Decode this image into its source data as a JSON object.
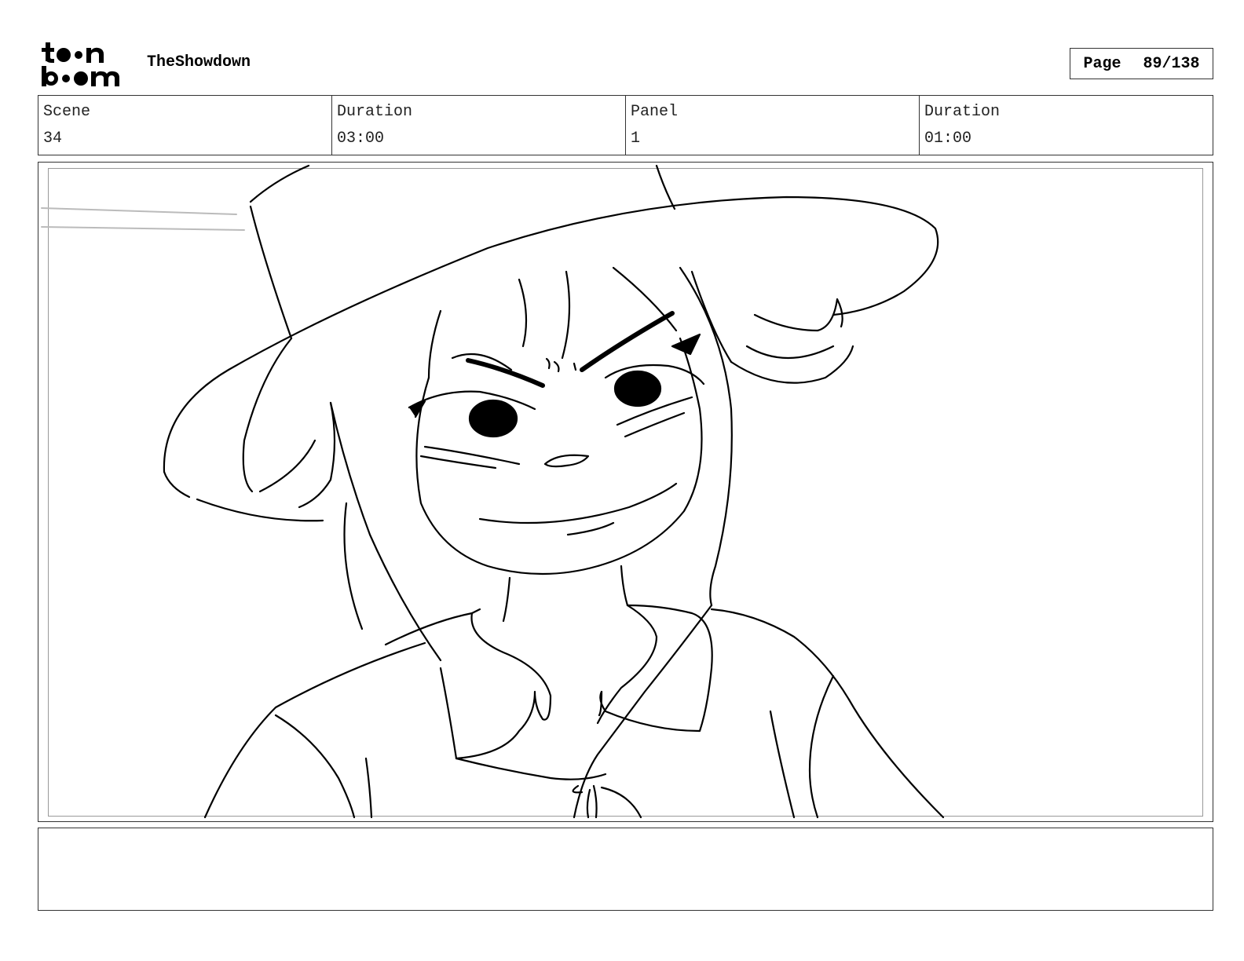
{
  "header": {
    "logo_text": "toonboom",
    "project_title": "TheShowdown",
    "page_label": "Page",
    "page_number": "89/138"
  },
  "info": {
    "scene_label": "Scene",
    "scene_value": "34",
    "scene_duration_label": "Duration",
    "scene_duration_value": "03:00",
    "panel_label": "Panel",
    "panel_value": "1",
    "panel_duration_label": "Duration",
    "panel_duration_value": "01:00"
  },
  "notes": {
    "text": ""
  }
}
